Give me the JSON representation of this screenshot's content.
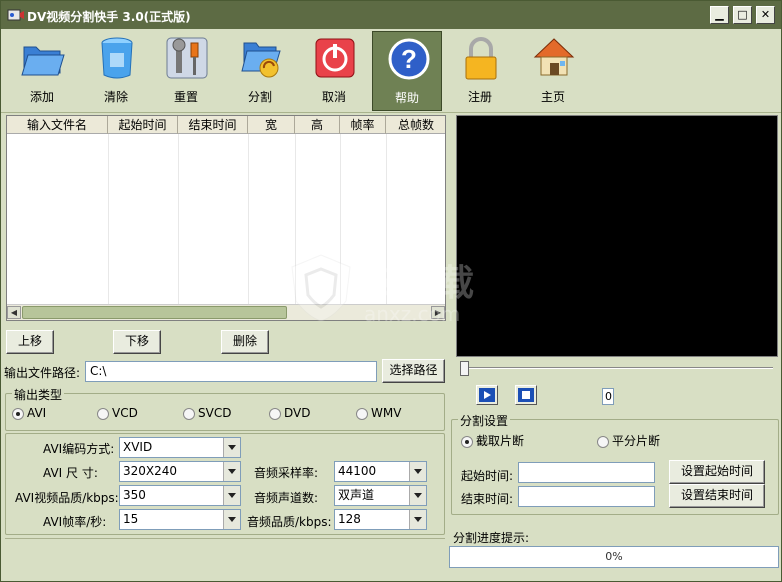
{
  "window": {
    "title": "DV视频分割快手 3.0(正式版)",
    "controls": {
      "minimize": "▁",
      "maximize": "□",
      "close": "✕"
    }
  },
  "toolbar": {
    "buttons": [
      {
        "label": "添加",
        "icon": "folder-icon"
      },
      {
        "label": "清除",
        "icon": "trash-can-icon"
      },
      {
        "label": "重置",
        "icon": "tools-icon"
      },
      {
        "label": "分割",
        "icon": "split-folder-icon"
      },
      {
        "label": "取消",
        "icon": "power-icon"
      },
      {
        "label": "帮助",
        "icon": "help-icon",
        "active": true
      },
      {
        "label": "注册",
        "icon": "lock-icon"
      },
      {
        "label": "主页",
        "icon": "home-icon"
      }
    ]
  },
  "file_list": {
    "columns": [
      "输入文件名",
      "起始时间",
      "结束时间",
      "宽",
      "高",
      "帧率",
      "总帧数"
    ]
  },
  "list_actions": {
    "up": "上移",
    "down": "下移",
    "delete": "删除"
  },
  "output": {
    "path_label": "输出文件路径:",
    "path_value": "C:\\",
    "choose_path": "选择路径"
  },
  "output_type": {
    "title": "输出类型",
    "options": [
      "AVI",
      "VCD",
      "SVCD",
      "DVD",
      "WMV"
    ],
    "selected": "AVI"
  },
  "avi_settings": {
    "encoder_label": "AVI编码方式:",
    "encoder_value": "XVID",
    "size_label": "AVI  尺  寸:",
    "size_value": "320X240",
    "quality_label": "AVI视频品质/kbps:",
    "quality_value": "350",
    "fps_label": "AVI帧率/秒:",
    "fps_value": "15",
    "sample_rate_label": "音频采样率:",
    "sample_rate_value": "44100",
    "channels_label": "音频声道数:",
    "channels_value": "双声道",
    "audio_quality_label": "音频品质/kbps:",
    "audio_quality_value": "128"
  },
  "player": {
    "frame_counter": "0",
    "play_icon": "play-icon",
    "stop_icon": "stop-icon"
  },
  "split_settings": {
    "title": "分割设置",
    "mode_capture": "截取片断",
    "mode_even": "平分片断",
    "selected": "截取片断",
    "start_label": "起始时间:",
    "end_label": "结束时间:",
    "start_value": "",
    "end_value": "",
    "set_start": "设置起始时间",
    "set_end": "设置结束时间"
  },
  "progress": {
    "label": "分割进度提示:",
    "text": "0%",
    "fraction": 0
  },
  "watermark": {
    "text": "安下载",
    "sub": "anxz.com"
  },
  "colors": {
    "titlebar": "#5d6b44",
    "window_bg": "#d8dfc4",
    "active_button": "#6f8154",
    "video_bg": "#000000",
    "play_blue": "#1b4fb5"
  }
}
